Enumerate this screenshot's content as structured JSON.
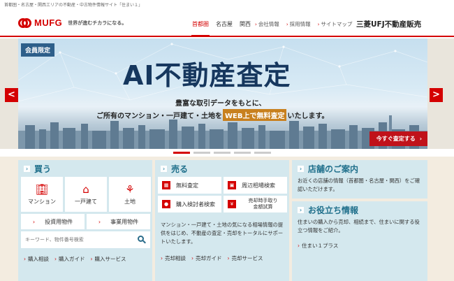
{
  "tagline": "首都圏・名古屋・関西エリアの不動産・中古物件情報サイト「住まい１」",
  "header": {
    "logo_text": "MUFG",
    "logo_sub": "世界が進むチカラになる。",
    "regions": [
      "首都圏",
      "名古屋",
      "関西"
    ],
    "links": [
      "会社情報",
      "採用情報",
      "サイトマップ"
    ],
    "company": "三菱UFJ不動産販売"
  },
  "hero": {
    "badge": "会員限定",
    "title": "AI不動産査定",
    "line1": "豊富な取引データをもとに、",
    "line2_pre": "ご所有のマンション・一戸建て・土地を",
    "line2_hl": "WEB上で無料査定",
    "line2_post": "いたします。",
    "cta": "今すぐ査定する",
    "prev": "<",
    "next": ">",
    "active_slide": 1,
    "slide_count": 5
  },
  "buy": {
    "title": "買う",
    "tiles": [
      {
        "label": "マンション",
        "icon": "building-icon"
      },
      {
        "label": "一戸建て",
        "icon": "house-icon"
      },
      {
        "label": "土地",
        "icon": "land-icon"
      }
    ],
    "buttons": [
      "投資用物件",
      "事業用物件"
    ],
    "search_placeholder": "キーワード、物件番号検索",
    "links": [
      "購入相談",
      "購入ガイド",
      "購入サービス"
    ]
  },
  "sell": {
    "title": "売る",
    "buttons": [
      {
        "label": "無料査定",
        "icon": "calculator-icon"
      },
      {
        "label": "周辺相場検索",
        "icon": "map-icon"
      },
      {
        "label": "購入検討者検索",
        "icon": "person-icon"
      },
      {
        "label_1": "売却時手取り",
        "label_2": "金額試算",
        "icon": "yen-icon"
      }
    ],
    "text": "マンション・一戸建て・土地の気になる相場情報の提供をはじめ、不動産の査定・売却をトータルにサポートいたします。",
    "links": [
      "売却相談",
      "売却ガイド",
      "売却サービス"
    ]
  },
  "info": {
    "stores_title": "店舗のご案内",
    "stores_text": "お近くの店舗の情報（首都圏・名古屋・関西）をご確認いただけます。",
    "tips_title": "お役立ち情報",
    "tips_text": "住まいの購入から売却、相続まで、住まいに関する役立つ情報をご紹介。",
    "links": [
      "住まい１プラス"
    ]
  },
  "colors": {
    "brand": "#d40000",
    "panel": "#d4e8ee",
    "heading": "#1f6f8b",
    "badge": "#2e5f8a",
    "highlight": "#c8801e"
  }
}
